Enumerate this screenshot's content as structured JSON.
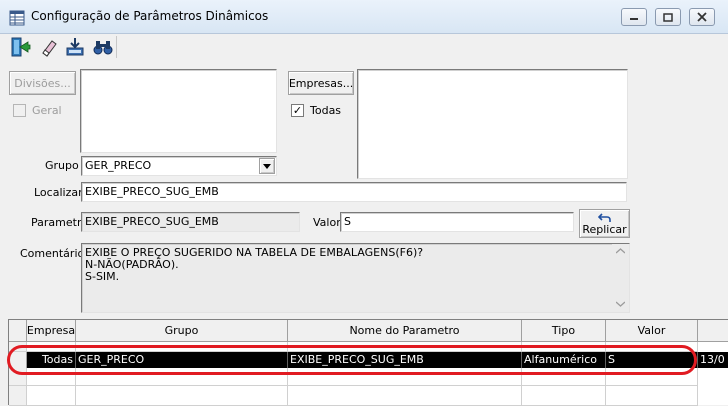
{
  "window": {
    "title": "Configuração de Parâmetros Dinâmicos"
  },
  "toolbar": {
    "icons": [
      "exit-icon",
      "eraser-icon",
      "save-icon",
      "find-icon"
    ]
  },
  "divisoes": {
    "button_label": "Divisões...",
    "geral_label": "Geral",
    "geral_checked": false
  },
  "empresas": {
    "button_label": "Empresas...",
    "todas_label": "Todas",
    "todas_checked": true,
    "todas_mark": "✓"
  },
  "grupo": {
    "label": "Grupo",
    "value": "GER_PRECO"
  },
  "localizar": {
    "label": "Localizar",
    "value": "EXIBE_PRECO_SUG_EMB"
  },
  "parametro": {
    "label": "Parametro",
    "value": "EXIBE_PRECO_SUG_EMB"
  },
  "valor": {
    "label": "Valor",
    "value": "S"
  },
  "replicar": {
    "label": "Replicar"
  },
  "comentarios": {
    "label": "Comentários",
    "lines": [
      "EXIBE O PREÇO SUGERIDO NA TABELA DE EMBALAGENS(F6)?",
      "N-NÃO(PADRÃO).",
      "S-SIM."
    ]
  },
  "grid": {
    "headers": [
      "Empresa",
      "Grupo",
      "Nome do Parametro",
      "Tipo",
      "Valor"
    ],
    "rows": [
      {
        "empresa": "Todas",
        "grupo": "GER_PRECO",
        "nome": "EXIBE_PRECO_SUG_EMB",
        "tipo": "Alfanumérico",
        "valor": "S",
        "extra": "13/0"
      }
    ]
  },
  "colors": {
    "highlight_ring": "#e11b22",
    "selected_row": "#000000"
  }
}
